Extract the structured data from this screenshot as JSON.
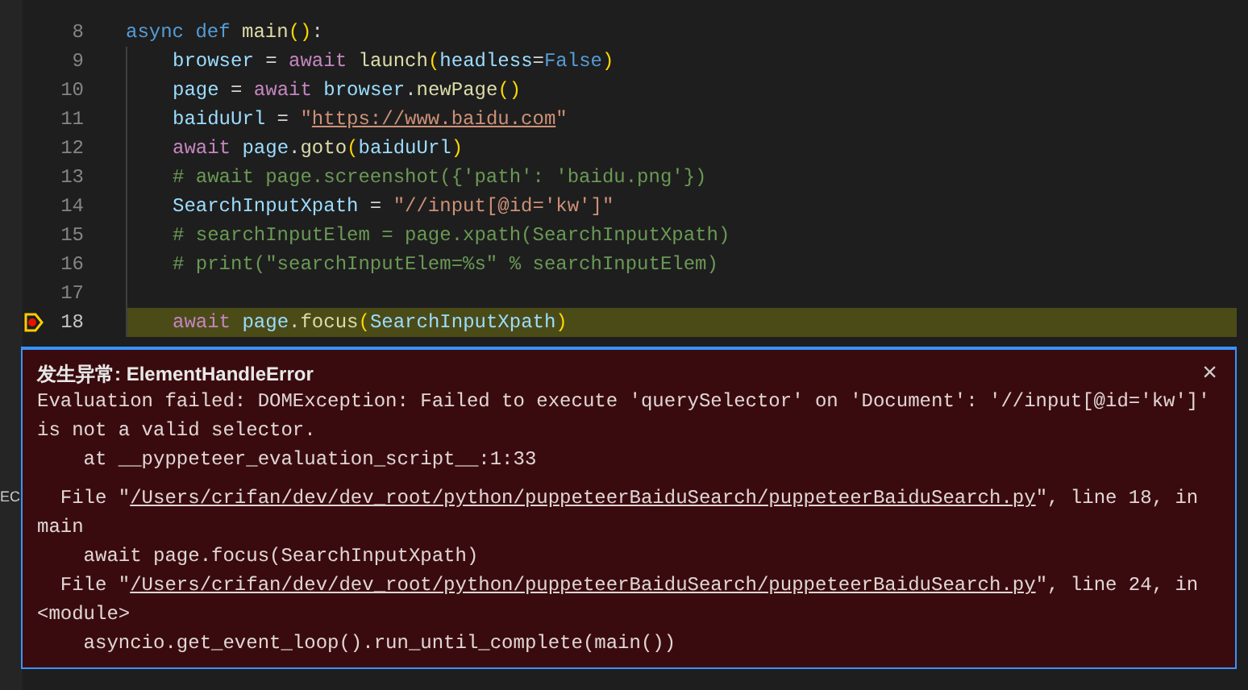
{
  "side_panel": {
    "label": "EC"
  },
  "editor": {
    "lines": [
      {
        "number": "8",
        "current": false,
        "breakpoint": false,
        "tokens": [
          {
            "text": "async def ",
            "kind": "keyword"
          },
          {
            "text": "main",
            "kind": "function"
          },
          {
            "text": "()",
            "kind": "bracket"
          },
          {
            "text": ":",
            "kind": "plain"
          }
        ],
        "children": [
          {
            "number": "9",
            "current": false,
            "breakpoint": false,
            "tokens": [
              {
                "text": "browser",
                "kind": "variable"
              },
              {
                "text": " = ",
                "kind": "plain"
              },
              {
                "text": "await ",
                "kind": "control"
              },
              {
                "text": "launch",
                "kind": "function"
              },
              {
                "text": "(",
                "kind": "bracket"
              },
              {
                "text": "headless",
                "kind": "variable"
              },
              {
                "text": "=",
                "kind": "plain"
              },
              {
                "text": "False",
                "kind": "keyword"
              },
              {
                "text": ")",
                "kind": "bracket"
              }
            ]
          },
          {
            "number": "10",
            "current": false,
            "breakpoint": false,
            "tokens": [
              {
                "text": "page",
                "kind": "variable"
              },
              {
                "text": " = ",
                "kind": "plain"
              },
              {
                "text": "await ",
                "kind": "control"
              },
              {
                "text": "browser",
                "kind": "variable"
              },
              {
                "text": ".",
                "kind": "plain"
              },
              {
                "text": "newPage",
                "kind": "function"
              },
              {
                "text": "()",
                "kind": "bracket"
              }
            ]
          },
          {
            "number": "11",
            "current": false,
            "breakpoint": false,
            "tokens": [
              {
                "text": "baiduUrl",
                "kind": "variable"
              },
              {
                "text": " = ",
                "kind": "plain"
              },
              {
                "text": "\"",
                "kind": "string"
              },
              {
                "text": "https://www.baidu.com",
                "kind": "link"
              },
              {
                "text": "\"",
                "kind": "string"
              }
            ]
          },
          {
            "number": "12",
            "current": false,
            "breakpoint": false,
            "tokens": [
              {
                "text": "await ",
                "kind": "control"
              },
              {
                "text": "page",
                "kind": "variable"
              },
              {
                "text": ".",
                "kind": "plain"
              },
              {
                "text": "goto",
                "kind": "function"
              },
              {
                "text": "(",
                "kind": "bracket"
              },
              {
                "text": "baiduUrl",
                "kind": "variable"
              },
              {
                "text": ")",
                "kind": "bracket"
              }
            ]
          },
          {
            "number": "13",
            "current": false,
            "breakpoint": false,
            "tokens": [
              {
                "text": "# await page.screenshot({'path': 'baidu.png'})",
                "kind": "comment"
              }
            ]
          },
          {
            "number": "14",
            "current": false,
            "breakpoint": false,
            "tokens": [
              {
                "text": "SearchInputXpath",
                "kind": "variable"
              },
              {
                "text": " = ",
                "kind": "plain"
              },
              {
                "text": "\"//input[@id='kw']\"",
                "kind": "string"
              }
            ]
          },
          {
            "number": "15",
            "current": false,
            "breakpoint": false,
            "tokens": [
              {
                "text": "# searchInputElem = page.xpath(SearchInputXpath)",
                "kind": "comment"
              }
            ]
          },
          {
            "number": "16",
            "current": false,
            "breakpoint": false,
            "tokens": [
              {
                "text": "# print(\"searchInputElem=%s\" % searchInputElem)",
                "kind": "comment"
              }
            ]
          },
          {
            "number": "17",
            "current": false,
            "breakpoint": false
          },
          {
            "number": "18",
            "current": true,
            "breakpoint": true,
            "tokens": [
              {
                "text": "await ",
                "kind": "control"
              },
              {
                "text": "page",
                "kind": "variable"
              },
              {
                "text": ".",
                "kind": "plain"
              },
              {
                "text": "focus",
                "kind": "function"
              },
              {
                "text": "(",
                "kind": "bracket"
              },
              {
                "text": "SearchInputXpath",
                "kind": "variable"
              },
              {
                "text": ")",
                "kind": "bracket"
              }
            ]
          }
        ]
      }
    ]
  },
  "exception": {
    "title": "发生异常: ElementHandleError",
    "blocks": [
      [
        [
          {
            "text": "Evaluation failed: DOMException: Failed to execute 'querySelector' on 'Document': '//input[@id='kw']'",
            "kind": "text"
          }
        ],
        [
          {
            "text": "is not a valid selector.",
            "kind": "text"
          }
        ],
        [
          {
            "text": "    at __pyppeteer_evaluation_script__:1:33",
            "kind": "text"
          }
        ]
      ],
      [
        [
          {
            "text": "  File \"",
            "kind": "text"
          },
          {
            "text": "/Users/crifan/dev/dev_root/python/puppeteerBaiduSearch/puppeteerBaiduSearch.py",
            "kind": "link"
          },
          {
            "text": "\", line 18, in",
            "kind": "text"
          }
        ],
        [
          {
            "text": "main",
            "kind": "text"
          }
        ],
        [
          {
            "text": "    await page.focus(SearchInputXpath)",
            "kind": "text"
          }
        ],
        [
          {
            "text": "  File \"",
            "kind": "text"
          },
          {
            "text": "/Users/crifan/dev/dev_root/python/puppeteerBaiduSearch/puppeteerBaiduSearch.py",
            "kind": "link"
          },
          {
            "text": "\", line 24, in",
            "kind": "text"
          }
        ],
        [
          {
            "text": "<module>",
            "kind": "text"
          }
        ],
        [
          {
            "text": "    asyncio.get_event_loop().run_until_complete(main())",
            "kind": "text"
          }
        ]
      ]
    ],
    "close": "×"
  }
}
